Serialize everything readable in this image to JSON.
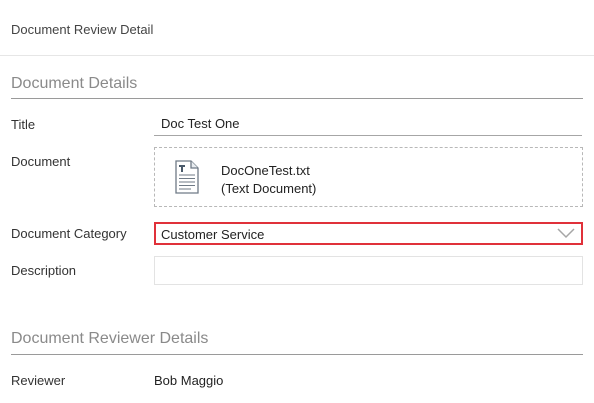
{
  "header": {
    "title": "Document Review Detail"
  },
  "document_details": {
    "heading": "Document Details",
    "title_label": "Title",
    "title_value": "Doc Test One",
    "document_label": "Document",
    "file_icon": "text-document-icon",
    "file_name": "DocOneTest.txt",
    "file_type": "(Text Document)",
    "category_label": "Document Category",
    "category_value": "Customer Service",
    "description_label": "Description",
    "description_value": ""
  },
  "reviewer_details": {
    "heading": "Document Reviewer Details",
    "reviewer_label": "Reviewer",
    "reviewer_value": "Bob Maggio"
  },
  "colors": {
    "highlight_border": "#e0313a",
    "section_heading": "#8a8a8a"
  }
}
